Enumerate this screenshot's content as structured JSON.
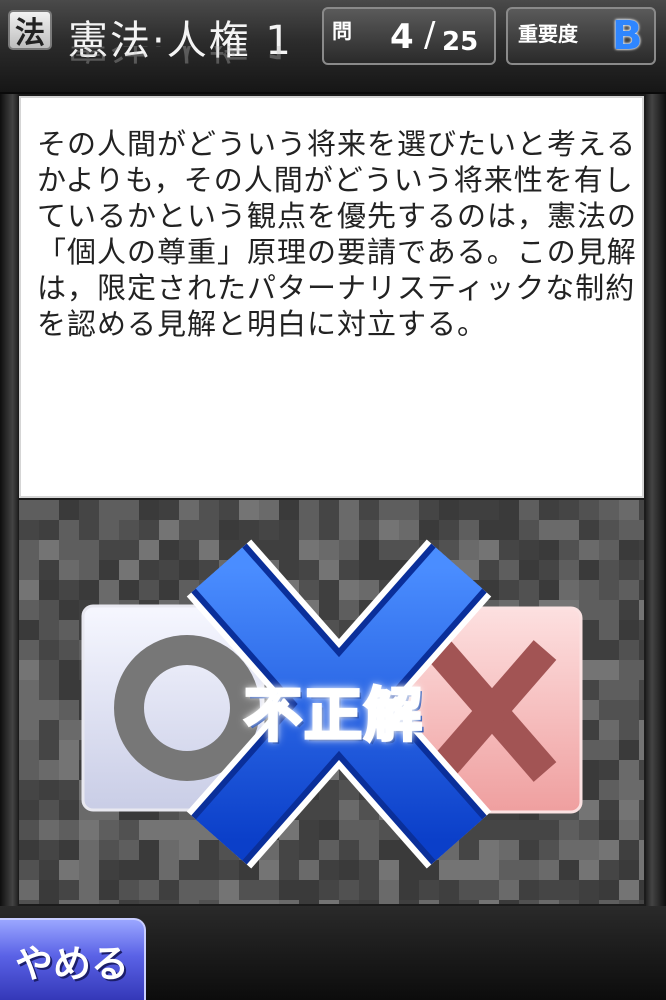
{
  "header": {
    "category_badge": "法",
    "title": "憲法·人権 1",
    "question_label": "問",
    "question_current": "4",
    "question_separator": "/",
    "question_total": "25",
    "importance_label": "重要度",
    "importance_grade": "B"
  },
  "question": {
    "text": "その人間がどういう将来を選びたいと考えるかよりも，その人間がどういう将来性を有しているかという観点を優先するのは，憲法の「個人の尊重」原理の要請である。この見解は，限定されたパターナリスティックな制約を認める見解と明白に対立する。"
  },
  "answer_area": {
    "choices": [
      {
        "symbol": "circle",
        "meaning": "correct-choice"
      },
      {
        "symbol": "cross",
        "meaning": "incorrect-choice"
      }
    ],
    "result_text": "不正解",
    "result_mark": "cross"
  },
  "footer": {
    "quit_label": "やめる"
  },
  "colors": {
    "accent_blue": "#1f6bff",
    "grade_blue": "#2f86ff",
    "quit_button": "#5a62e6",
    "wrong_card": "#f4b8b8"
  }
}
